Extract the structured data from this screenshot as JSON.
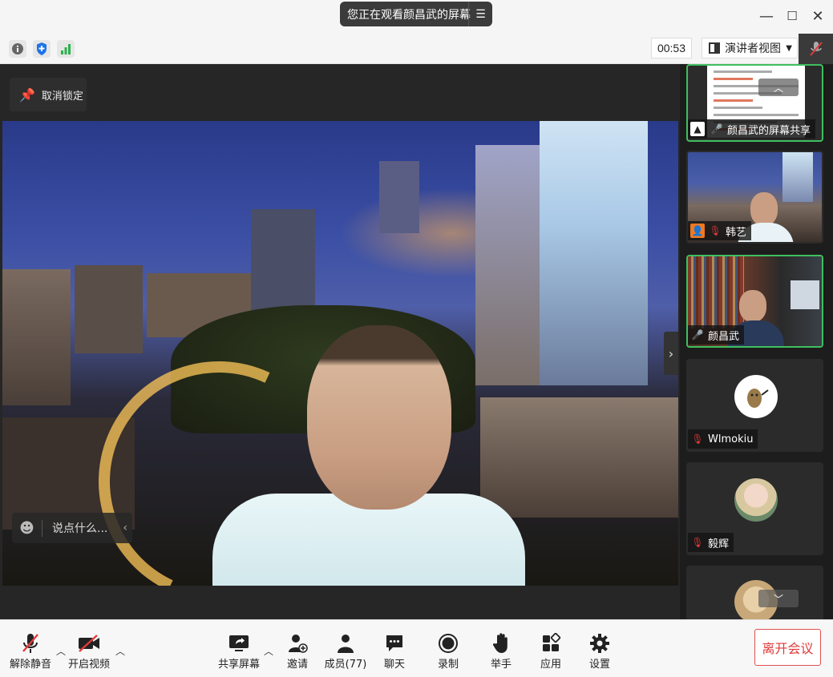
{
  "titlebar": {
    "sharing_notice": "您正在观看颜昌武的屏幕",
    "menu_icon": "list-icon",
    "minimize": "—",
    "maximize": "☐",
    "close": "✕"
  },
  "toolrow": {
    "icons": [
      "info-icon",
      "shield-icon",
      "signal-icon"
    ],
    "timer": "00:53",
    "view_mode": "演讲者视图",
    "colors": {
      "shield": "#1e73e8",
      "signal": "#2bb24c"
    }
  },
  "stage": {
    "unlock_label": "取消锁定",
    "chat_placeholder": "说点什么..."
  },
  "participants": [
    {
      "name": "颜昌武的屏幕共享",
      "type": "screen",
      "mic": "on",
      "active": true
    },
    {
      "name": "韩艺",
      "type": "video",
      "mic": "off",
      "active": false
    },
    {
      "name": "颜昌武",
      "type": "video",
      "mic": "on",
      "active": true
    },
    {
      "name": "Wlmokiu",
      "type": "avatar",
      "mic": "off",
      "active": false
    },
    {
      "name": "毅辉",
      "type": "avatar",
      "mic": "off",
      "active": false
    }
  ],
  "bottombar": {
    "unmute": "解除静音",
    "start_video": "开启视频",
    "share_screen": "共享屏幕",
    "invite": "邀请",
    "members": "成员(77)",
    "chat": "聊天",
    "record": "录制",
    "raise_hand": "举手",
    "apps": "应用",
    "settings": "设置",
    "leave": "离开会议",
    "colors": {
      "leave": "#e03a3a",
      "muted": "#e03a3a"
    }
  }
}
